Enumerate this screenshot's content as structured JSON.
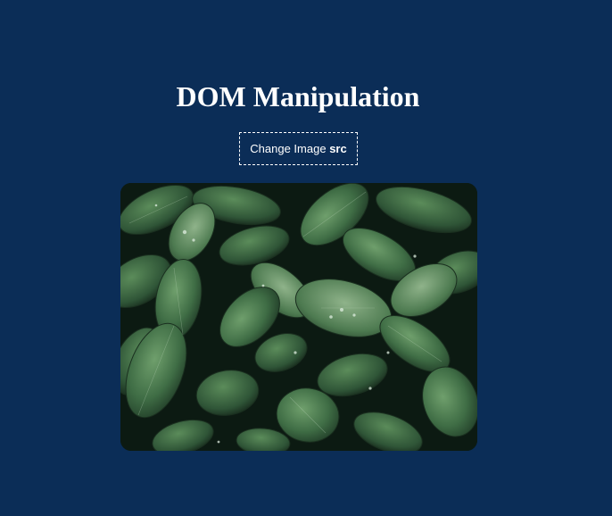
{
  "page": {
    "title": "DOM Manipulation"
  },
  "button": {
    "label_prefix": "Change Image ",
    "label_code": "src"
  },
  "image": {
    "subject": "leaves-with-water-droplets"
  },
  "colors": {
    "background": "#0b2d57",
    "text": "#ffffff"
  }
}
